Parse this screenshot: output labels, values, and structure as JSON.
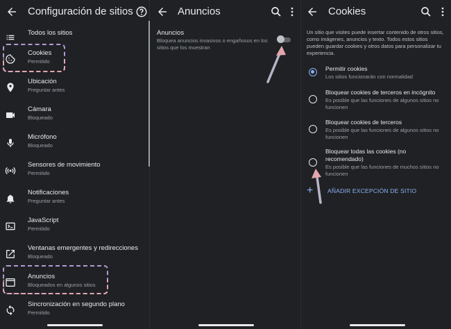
{
  "panel1": {
    "title": "Configuración de sitios",
    "items": [
      {
        "label": "Todos los sitios",
        "sub": ""
      },
      {
        "label": "Cookies",
        "sub": "Permitido"
      },
      {
        "label": "Ubicación",
        "sub": "Preguntar antes"
      },
      {
        "label": "Cámara",
        "sub": "Bloqueado"
      },
      {
        "label": "Micrófono",
        "sub": "Bloqueado"
      },
      {
        "label": "Sensores de movimiento",
        "sub": "Permitido"
      },
      {
        "label": "Notificaciones",
        "sub": "Preguntar antes"
      },
      {
        "label": "JavaScript",
        "sub": "Permitido"
      },
      {
        "label": "Ventanas emergentes y redirecciones",
        "sub": "Bloqueado"
      },
      {
        "label": "Anuncios",
        "sub": "Bloqueados en algunos sitios"
      },
      {
        "label": "Sincronización en segundo plano",
        "sub": "Permitido"
      }
    ]
  },
  "panel2": {
    "title": "Anuncios",
    "setting_title": "Anuncios",
    "setting_desc": "Bloquea anuncios invasivos o engañosos en los sitios que los muestran",
    "toggle_on": false
  },
  "panel3": {
    "title": "Cookies",
    "intro": "Un sitio que visites puede insertar contenido de otros sitios, como imágenes, anuncios y texto. Todos estos sitios pueden guardar cookies y otros datos para personalizar tu experiencia.",
    "options": [
      {
        "label": "Permitir cookies",
        "sub": "Los sitios funcionarán con normalidad",
        "selected": true
      },
      {
        "label": "Bloquear cookies de terceros en incógnito",
        "sub": "Es posible que las funciones de algunos sitios no funcionen",
        "selected": false
      },
      {
        "label": "Bloquear cookies de terceros",
        "sub": "Es posible que las funciones de algunos sitios no funcionen",
        "selected": false
      },
      {
        "label": "Bloquear todas las cookies (no recomendado)",
        "sub": "Es posible que las funciones de muchos sitios no funcionen",
        "selected": false
      }
    ],
    "add_exception": "AÑADIR EXCEPCIÓN DE SITIO"
  },
  "colors": {
    "background": "#202124",
    "accent": "#8ab4f8",
    "highlight_top": "#b39ad6",
    "highlight_bottom": "#e2a7ad",
    "arrow": "#e2a7ad"
  }
}
